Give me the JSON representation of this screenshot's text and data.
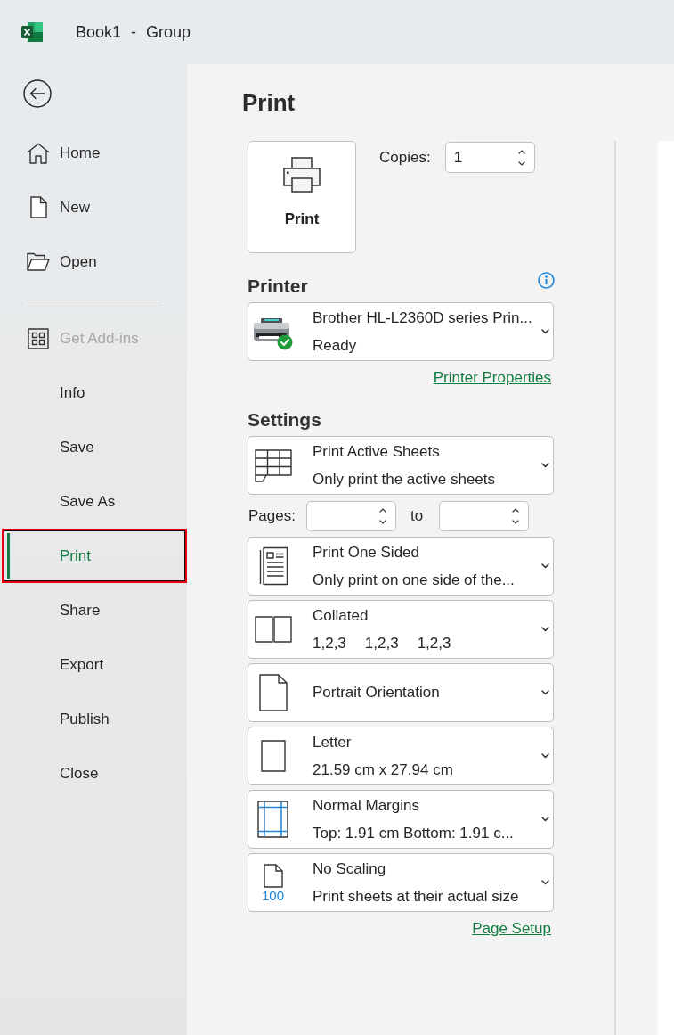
{
  "window": {
    "title": "Book1 - Group"
  },
  "sidebar": {
    "top_items": [
      {
        "label": "Home",
        "kind": "icon",
        "selected": false,
        "disabled": false
      },
      {
        "label": "New",
        "kind": "icon",
        "selected": false,
        "disabled": false
      },
      {
        "label": "Open",
        "kind": "icon",
        "selected": false,
        "disabled": false
      }
    ],
    "items": [
      {
        "label": "Get Add-ins",
        "kind": "icon",
        "selected": false,
        "disabled": true
      },
      {
        "label": "Info",
        "kind": "text",
        "selected": false,
        "disabled": false
      },
      {
        "label": "Save",
        "kind": "text",
        "selected": false,
        "disabled": false
      },
      {
        "label": "Save As",
        "kind": "text",
        "selected": false,
        "disabled": false
      },
      {
        "label": "Print",
        "kind": "text",
        "selected": true,
        "disabled": false
      },
      {
        "label": "Share",
        "kind": "text",
        "selected": false,
        "disabled": false
      },
      {
        "label": "Export",
        "kind": "text",
        "selected": false,
        "disabled": false
      },
      {
        "label": "Publish",
        "kind": "text",
        "selected": false,
        "disabled": false
      },
      {
        "label": "Close",
        "kind": "text",
        "selected": false,
        "disabled": false
      }
    ]
  },
  "print_panel": {
    "heading": "Print",
    "print_button": {
      "label": "Print"
    },
    "copies": {
      "label": "Copies:",
      "value": "1"
    },
    "printer": {
      "heading": "Printer",
      "name": "Brother HL-L2360D series Prin...",
      "status": "Ready",
      "link": "Printer Properties"
    },
    "settings": {
      "heading": "Settings",
      "items": [
        {
          "kind": "dropdown",
          "title": "Print Active Sheets",
          "detail": "Only print the active sheets"
        },
        {
          "kind": "pages",
          "label": "Pages:",
          "to_label": "to"
        },
        {
          "kind": "dropdown",
          "title": "Print One Sided",
          "detail": "Only print on one side of the..."
        },
        {
          "kind": "dropdown",
          "title": "Collated",
          "detail_parts": [
            "1,2,3",
            "1,2,3",
            "1,2,3"
          ]
        },
        {
          "kind": "dropdown",
          "title": "Portrait Orientation"
        },
        {
          "kind": "dropdown",
          "title": "Letter",
          "detail": "21.59 cm x 27.94 cm"
        },
        {
          "kind": "dropdown",
          "title": "Normal Margins",
          "detail": "Top: 1.91 cm Bottom: 1.91 c..."
        },
        {
          "kind": "dropdown",
          "title": "No Scaling",
          "detail": "Print sheets at their actual size",
          "icon_text": "100"
        }
      ],
      "link": "Page Setup"
    }
  }
}
